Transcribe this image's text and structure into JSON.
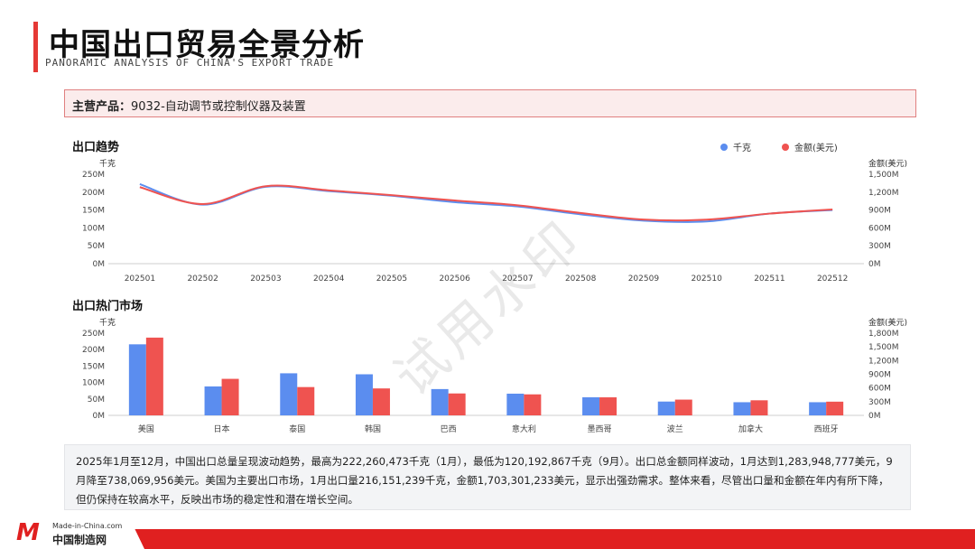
{
  "header": {
    "title": "中国出口贸易全景分析",
    "subtitle": "PANORAMIC ANALYSIS OF CHINA'S EXPORT TRADE"
  },
  "product": {
    "label": "主营产品：",
    "value": "9032-自动调节或控制仪器及装置"
  },
  "colors": {
    "kg": "#5b8def",
    "amount": "#ef5350",
    "accent": "#e53935"
  },
  "chart_data": [
    {
      "type": "line",
      "title": "出口趋势",
      "x": [
        "202501",
        "202502",
        "202503",
        "202504",
        "202505",
        "202506",
        "202507",
        "202508",
        "202509",
        "202510",
        "202511",
        "202512"
      ],
      "series": [
        {
          "name": "千克",
          "axis": "left",
          "values": [
            222260473,
            165000000,
            215000000,
            203000000,
            190000000,
            172000000,
            160000000,
            138000000,
            120192867,
            118000000,
            140000000,
            150000000
          ]
        },
        {
          "name": "金额(美元)",
          "axis": "right",
          "values": [
            1283948777,
            1000000000,
            1300000000,
            1230000000,
            1150000000,
            1060000000,
            980000000,
            850000000,
            740000000,
            738069956,
            840000000,
            910000000
          ]
        }
      ],
      "ylabel_left": "千克",
      "ylabel_right": "金额(美元)",
      "ylim_left": [
        0,
        250000000
      ],
      "ylim_right": [
        0,
        1500000000
      ],
      "yticks_left": [
        "0M",
        "50M",
        "100M",
        "150M",
        "200M",
        "250M"
      ],
      "yticks_right": [
        "0M",
        "300M",
        "600M",
        "900M",
        "1,200M",
        "1,500M"
      ],
      "legend": "top-right",
      "grid": false
    },
    {
      "type": "bar",
      "title": "出口热门市场",
      "categories": [
        "美国",
        "日本",
        "泰国",
        "韩国",
        "巴西",
        "意大利",
        "墨西哥",
        "波兰",
        "加拿大",
        "西班牙"
      ],
      "series": [
        {
          "name": "千克",
          "axis": "left",
          "values": [
            216151239,
            88000000,
            128000000,
            125000000,
            80000000,
            66000000,
            55000000,
            42000000,
            40000000,
            40000000
          ]
        },
        {
          "name": "金额(美元)",
          "axis": "right",
          "values": [
            1703301233,
            800000000,
            620000000,
            590000000,
            480000000,
            460000000,
            395000000,
            345000000,
            330000000,
            300000000
          ]
        }
      ],
      "ylabel_left": "千克",
      "ylabel_right": "金额(美元)",
      "ylim_left": [
        0,
        250000000
      ],
      "ylim_right": [
        0,
        1800000000
      ],
      "yticks_left": [
        "0M",
        "50M",
        "100M",
        "150M",
        "200M",
        "250M"
      ],
      "yticks_right": [
        "0M",
        "300M",
        "600M",
        "900M",
        "1,200M",
        "1,500M",
        "1,800M"
      ],
      "grid": false
    }
  ],
  "summary": "2025年1月至12月，中国出口总量呈现波动趋势，最高为222,260,473千克（1月），最低为120,192,867千克（9月）。出口总金额同样波动，1月达到1,283,948,777美元，9月降至738,069,956美元。美国为主要出口市场，1月出口量216,151,239千克，金额1,703,301,233美元，显示出强劲需求。整体来看，尽管出口量和金额在年内有所下降，但仍保持在较高水平，反映出市场的稳定性和潜在增长空间。",
  "watermark": "试用水印",
  "footer": {
    "logo_mark": "M",
    "logo_top": "Made-in-China.com",
    "logo_bottom": "中国制造网"
  }
}
